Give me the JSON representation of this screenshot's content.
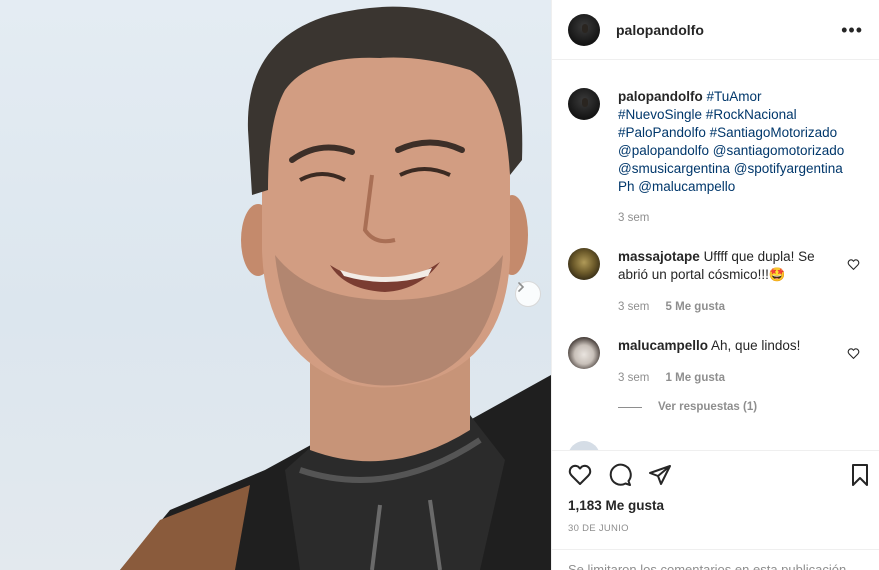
{
  "post": {
    "author": "palopandolfo",
    "more_icon": "more-horizontal-icon"
  },
  "caption": {
    "username": "palopandolfo",
    "text": "#TuAmor #NuevoSingle #RockNacional #PaloPandolfo #SantiagoMotorizado @palopandolfo @santiagomotorizado @smusicargentina @spotifyargentina Ph @malucampello",
    "time": "3 sem"
  },
  "comments": [
    {
      "username": "massajotape",
      "text": "Uffff que dupla! Se abrió un portal cósmico!!!🤩",
      "time": "3 sem",
      "likes": "5 Me gusta"
    },
    {
      "username": "malucampello",
      "text": "Ah, que lindos!",
      "time": "3 sem",
      "likes": "1 Me gusta"
    }
  ],
  "view_replies": "Ver respuestas (1)",
  "partial_comment_text": "",
  "actions": {
    "like_icon": "heart-icon",
    "comment_icon": "comment-icon",
    "share_icon": "paper-plane-icon",
    "save_icon": "bookmark-icon"
  },
  "likes_count": "1,183 Me gusta",
  "date": "30 DE JUNIO",
  "comments_restricted": "Se limitaron los comentarios en esta publicación."
}
